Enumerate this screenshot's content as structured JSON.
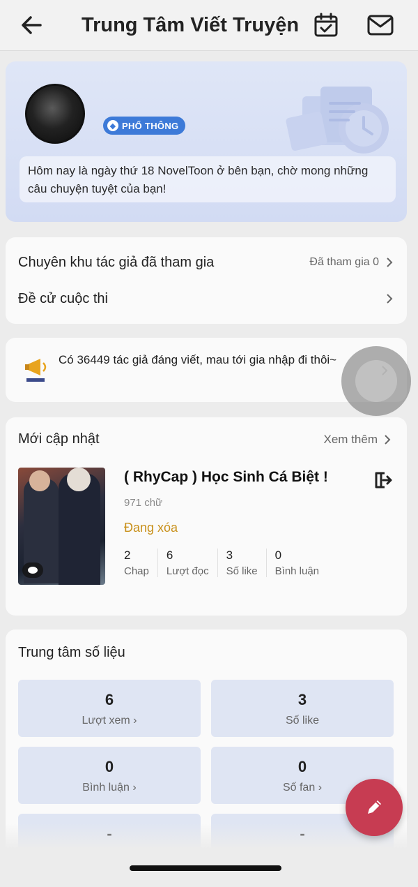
{
  "header": {
    "title": "Trung Tâm Viết Truyện",
    "back_icon": "arrow-left-icon",
    "calendar_icon": "calendar-check-icon",
    "mail_icon": "mail-icon"
  },
  "profile": {
    "badge": "PHỔ THÔNG",
    "greeting": "Hôm nay là ngày thứ 18 NovelToon ở bên bạn, chờ mong những câu chuyện tuyệt của bạn!"
  },
  "menu": {
    "items": [
      {
        "label": "Chuyên khu tác giả đã tham gia",
        "value": "Đã tham gia 0"
      },
      {
        "label": "Đề cử cuộc thi",
        "value": ""
      }
    ]
  },
  "promo": {
    "text": "Có 36449 tác giả đáng viết, mau tới gia nhập đi thôi~"
  },
  "recent": {
    "title": "Mới cập nhật",
    "see_more": "Xem thêm",
    "book": {
      "title": "( RhyCap ) Học Sinh Cá Biệt !",
      "word_count": "971 chữ",
      "status": "Đang xóa",
      "stats": [
        {
          "value": "2",
          "label": "Chap"
        },
        {
          "value": "6",
          "label": "Lượt đọc"
        },
        {
          "value": "3",
          "label": "Số like"
        },
        {
          "value": "0",
          "label": "Bình luận"
        }
      ]
    }
  },
  "data_center": {
    "title": "Trung tâm số liệu",
    "tiles": [
      {
        "value": "6",
        "label": "Lượt xem",
        "chevron": true
      },
      {
        "value": "3",
        "label": "Số like",
        "chevron": false
      },
      {
        "value": "0",
        "label": "Bình luận",
        "chevron": true
      },
      {
        "value": "0",
        "label": "Số fan",
        "chevron": true
      },
      {
        "value": "-",
        "label": ""
      },
      {
        "value": "-",
        "label": ""
      }
    ]
  },
  "colors": {
    "accent_red": "#c73c52",
    "badge_blue": "#3d7ad8",
    "status_orange": "#c8901a"
  }
}
